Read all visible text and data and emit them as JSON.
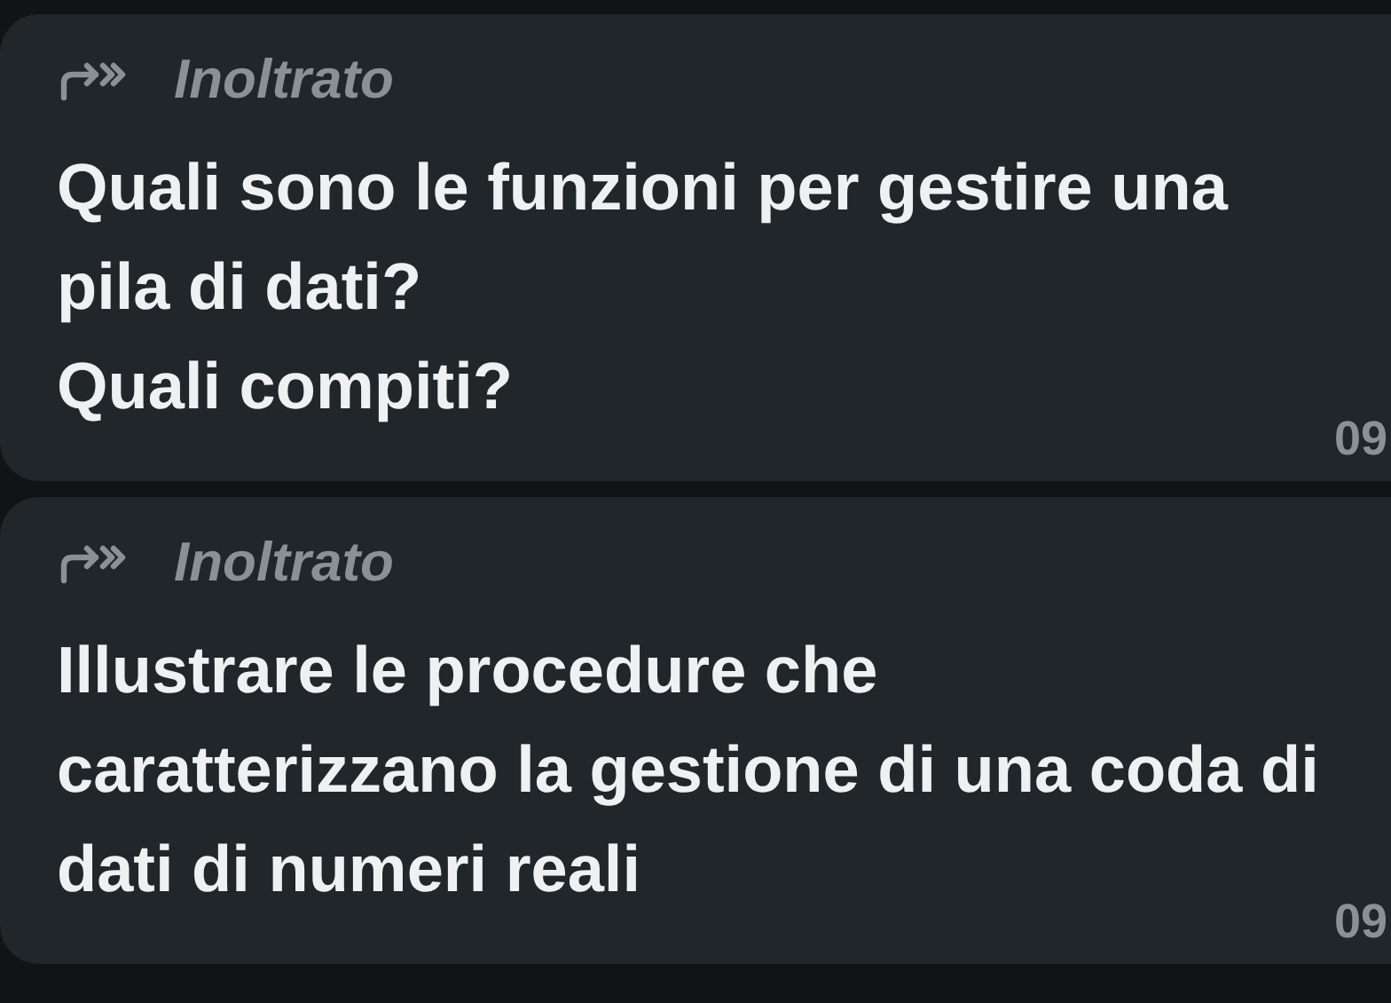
{
  "messages": [
    {
      "forwarded_label": "Inoltrato",
      "text": "Quali sono le funzioni per gestire una pila di dati?\nQuali compiti?",
      "time": "09"
    },
    {
      "forwarded_label": "Inoltrato",
      "text": "Illustrare le procedure che caratterizzano la gestione di una coda di dati di numeri reali",
      "time": "09"
    }
  ]
}
